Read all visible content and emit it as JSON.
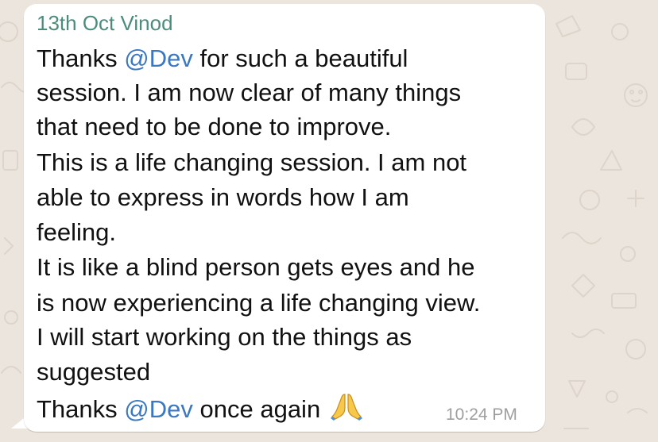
{
  "message": {
    "sender": "13th Oct Vinod",
    "time": "10:24 PM",
    "lines": [
      {
        "before": "Thanks ",
        "mention": "@Dev",
        "after": " for such a beautiful"
      },
      {
        "text": "session. I am now clear of many things"
      },
      {
        "text": "that need to be done to improve."
      },
      {
        "text": "This is a life changing session. I am not"
      },
      {
        "text": "able to express in words how I am"
      },
      {
        "text": "feeling."
      },
      {
        "text": "It is like a blind person gets eyes and he"
      },
      {
        "text": "is now experiencing a life changing view."
      },
      {
        "text": "I will start working on the things as"
      },
      {
        "text": "suggested"
      },
      {
        "before": "Thanks ",
        "mention": "@Dev",
        "after": " once again "
      }
    ],
    "emoji": "folded-hands-emoji"
  },
  "colors": {
    "background": "#ece5dd",
    "bubble": "#ffffff",
    "sender": "#4c8c7c",
    "mention": "#3a78c3",
    "text": "#111111",
    "time": "#9e9e9e"
  }
}
